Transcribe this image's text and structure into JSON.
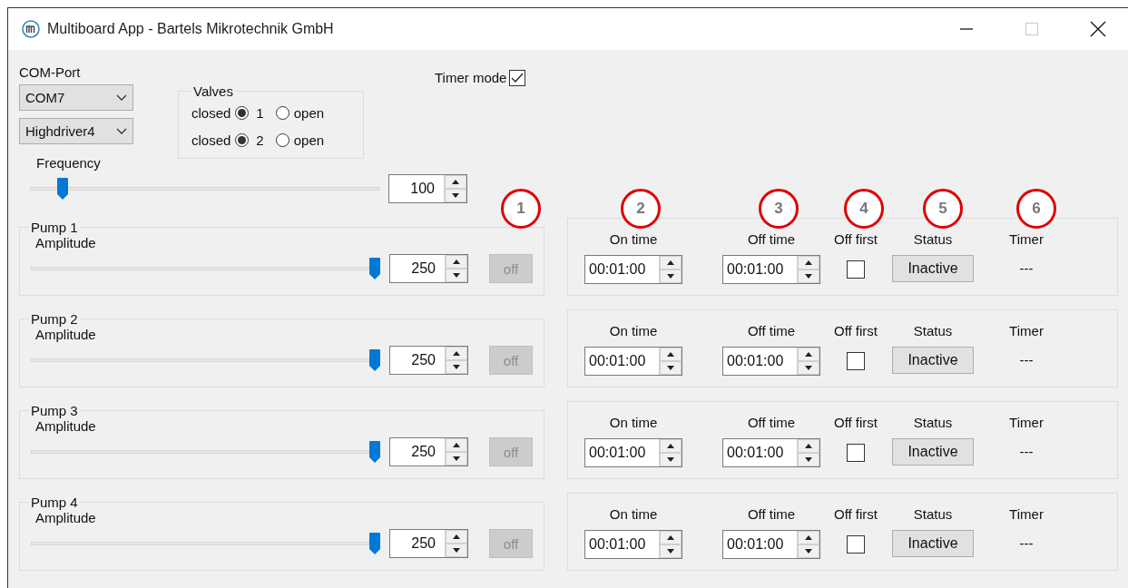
{
  "window": {
    "title": "Multiboard App - Bartels Mikrotechnik GmbH",
    "maximize_disabled": true
  },
  "com_port": {
    "label": "COM-Port",
    "port": "COM7",
    "driver": "Highdriver4"
  },
  "valves": {
    "title": "Valves",
    "rows": [
      {
        "number": "1",
        "options": [
          {
            "label": "closed",
            "selected": true
          },
          {
            "label": "open",
            "selected": false
          }
        ]
      },
      {
        "number": "2",
        "options": [
          {
            "label": "closed",
            "selected": true
          },
          {
            "label": "open",
            "selected": false
          }
        ]
      }
    ]
  },
  "timer_mode": {
    "label": "Timer mode",
    "checked": true
  },
  "frequency": {
    "label": "Frequency",
    "level": 0.08,
    "value": "100"
  },
  "callouts": [
    {
      "label": "1"
    },
    {
      "label": "2"
    },
    {
      "label": "3"
    },
    {
      "label": "4"
    },
    {
      "label": "5"
    },
    {
      "label": "6"
    }
  ],
  "pumps": [
    {
      "name": "Pump 1",
      "amplitude_label": "Amplitude",
      "level": 1,
      "value": "250",
      "button": "off",
      "button_disabled": true,
      "on_time_label": "On time",
      "on_time": "00:01:00",
      "off_time_label": "Off time",
      "off_time": "00:01:00",
      "off_first_label": "Off first",
      "off_first": false,
      "status_label": "Status",
      "status": "Inactive",
      "timer_label": "Timer",
      "timer": "---"
    },
    {
      "name": "Pump 2",
      "amplitude_label": "Amplitude",
      "level": 1,
      "value": "250",
      "button": "off",
      "button_disabled": true,
      "on_time_label": "On time",
      "on_time": "00:01:00",
      "off_time_label": "Off time",
      "off_time": "00:01:00",
      "off_first_label": "Off first",
      "off_first": false,
      "status_label": "Status",
      "status": "Inactive",
      "timer_label": "Timer",
      "timer": "---"
    },
    {
      "name": "Pump 3",
      "amplitude_label": "Amplitude",
      "level": 1,
      "value": "250",
      "button": "off",
      "button_disabled": true,
      "on_time_label": "On time",
      "on_time": "00:01:00",
      "off_time_label": "Off time",
      "off_time": "00:01:00",
      "off_first_label": "Off first",
      "off_first": false,
      "status_label": "Status",
      "status": "Inactive",
      "timer_label": "Timer",
      "timer": "---"
    },
    {
      "name": "Pump 4",
      "amplitude_label": "Amplitude",
      "level": 1,
      "value": "250",
      "button": "off",
      "button_disabled": true,
      "on_time_label": "On time",
      "on_time": "00:01:00",
      "off_time_label": "Off time",
      "off_time": "00:01:00",
      "off_first_label": "Off first",
      "off_first": false,
      "status_label": "Status",
      "status": "Inactive",
      "timer_label": "Timer",
      "timer": "---"
    }
  ]
}
